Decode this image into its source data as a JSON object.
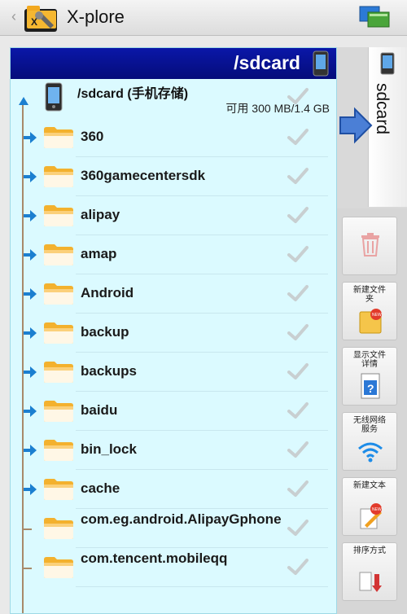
{
  "app": {
    "title": "X-plore"
  },
  "panel": {
    "path": "/sdcard",
    "root": {
      "name": "/sdcard (手机存储)",
      "space": "可用 300 MB/1.4 GB"
    },
    "items": [
      {
        "name": "360",
        "expandable": true
      },
      {
        "name": "360gamecentersdk",
        "expandable": true
      },
      {
        "name": "alipay",
        "expandable": true
      },
      {
        "name": "amap",
        "expandable": true
      },
      {
        "name": "Android",
        "expandable": true
      },
      {
        "name": "backup",
        "expandable": true
      },
      {
        "name": "backups",
        "expandable": true
      },
      {
        "name": "baidu",
        "expandable": true
      },
      {
        "name": "bin_lock",
        "expandable": true
      },
      {
        "name": "cache",
        "expandable": true
      },
      {
        "name": "com.eg.android.AlipayGphone",
        "expandable": false
      },
      {
        "name": "com.tencent.mobileqq",
        "expandable": false
      }
    ]
  },
  "side": {
    "tab_label": "sdcard",
    "tools": [
      {
        "label": "",
        "icon": "trash-icon"
      },
      {
        "label": "新建文件夹",
        "icon": "new-folder-icon"
      },
      {
        "label": "显示文件详情",
        "icon": "file-details-icon"
      },
      {
        "label": "无线网络服务",
        "icon": "wifi-icon"
      },
      {
        "label": "新建文本",
        "icon": "new-text-icon"
      },
      {
        "label": "排序方式",
        "icon": "sort-icon"
      }
    ]
  },
  "colors": {
    "header": "#0a17a8",
    "panel": "#dbfaff",
    "arrow": "#1b7fd0"
  }
}
